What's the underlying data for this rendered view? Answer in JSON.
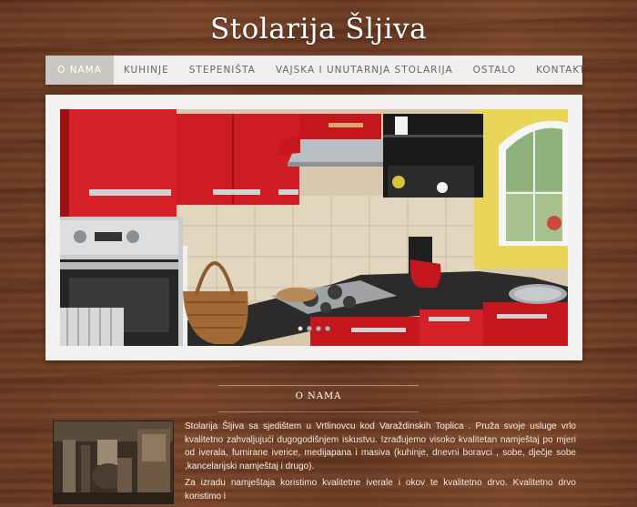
{
  "site": {
    "title": "Stolarija Šljiva"
  },
  "nav": {
    "items": [
      {
        "label": "O NAMA",
        "active": true
      },
      {
        "label": "KUHINJE"
      },
      {
        "label": "STEPENIŠTA"
      },
      {
        "label": "VAJSKA I UNUTARNJA STOLARIJA"
      },
      {
        "label": "OSTALO"
      },
      {
        "label": "KONTAKT"
      }
    ]
  },
  "slider": {
    "slide_count": 4,
    "active_index": 0
  },
  "about": {
    "title": "O NAMA",
    "paragraph1": "Stolarija Šljiva sa sjedištem u Vrtlinovcu kod Varaždinskih Toplica . Pruža svoje usluge vrlo kvalitetno zahvaljujući dugogodišnjem iskustvu. Izrađujemo visoko kvalitetan namještaj po mjeri od iverala, furnirane iverice, medijapana i masiva (kuhinje, dnevni boravci , sobe, dječje sobe ,kancelarijski namještaj i drugo).",
    "paragraph2": "Za izradu namještaja koristimo kvalitetne iverale i okov te kvalitetno drvo. Kvalitetno drvo koristimo i"
  },
  "colors": {
    "kitchen_red": "#c4161c",
    "nav_active": "#c9c7c4",
    "wood": "#6b3a22"
  }
}
